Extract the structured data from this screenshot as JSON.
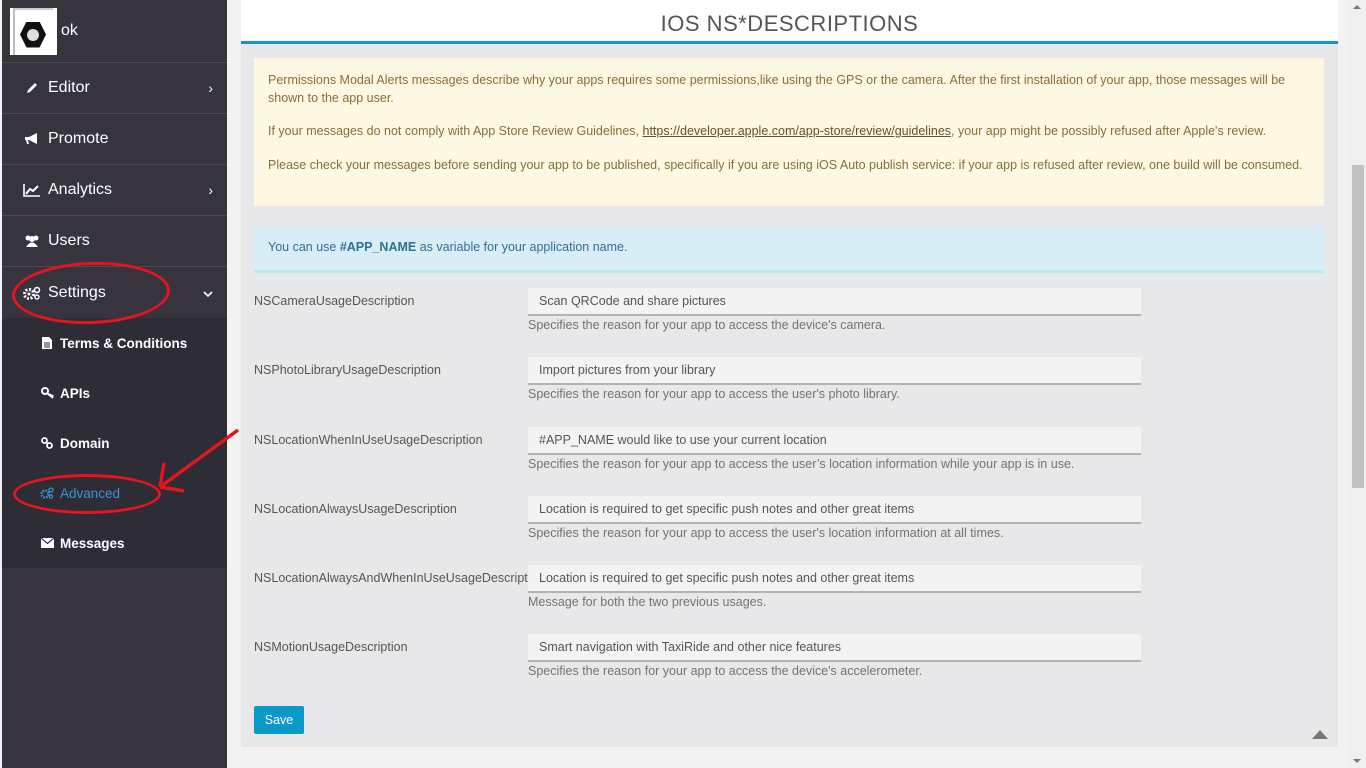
{
  "app": {
    "name": "ok"
  },
  "sidebar": {
    "items": [
      {
        "label": "Editor",
        "icon": "pencil-icon",
        "glyph": "✎",
        "chevron": "›"
      },
      {
        "label": "Promote",
        "icon": "bullhorn-icon",
        "glyph": "📢",
        "chevron": ""
      },
      {
        "label": "Analytics",
        "icon": "line-chart-icon",
        "glyph": "📈",
        "chevron": "›"
      },
      {
        "label": "Users",
        "icon": "users-icon",
        "glyph": "👥",
        "chevron": ""
      },
      {
        "label": "Settings",
        "icon": "gears-icon",
        "glyph": "⚙",
        "chevron": "⌄"
      }
    ],
    "settings_submenu": [
      {
        "label": "Terms & Conditions",
        "icon": "file-icon",
        "glyph": "📄"
      },
      {
        "label": "APIs",
        "icon": "key-icon",
        "glyph": "🔑"
      },
      {
        "label": "Domain",
        "icon": "link-icon",
        "glyph": "🔗"
      },
      {
        "label": "Advanced",
        "icon": "gears-icon",
        "glyph": "⚙",
        "active": true
      },
      {
        "label": "Messages",
        "icon": "envelope-icon",
        "glyph": "✉"
      }
    ]
  },
  "page": {
    "title": "IOS NS*DESCRIPTIONS",
    "warning": {
      "p1": "Permissions Modal Alerts messages describe why your apps requires some permissions,like using the GPS or the camera. After the first installation of your app, those messages will be shown to the app user.",
      "p2_before": "If your messages do not comply with App Store Review Guidelines, ",
      "p2_link": "https://developer.apple.com/app-store/review/guidelines",
      "p2_after": ", your app might be possibly refused after Apple's review.",
      "p3": "Please check your messages before sending your app to be published, specifically if you are using iOS Auto publish service: if your app is refused after review, one build will be consumed."
    },
    "info": {
      "before": "You can use ",
      "variable": "#APP_NAME",
      "after": " as variable for your application name."
    },
    "fields": [
      {
        "label": "NSCameraUsageDescription",
        "value": "Scan QRCode and share pictures",
        "help": "Specifies the reason for your app to access the device's camera."
      },
      {
        "label": "NSPhotoLibraryUsageDescription",
        "value": "Import pictures from your library",
        "help": "Specifies the reason for your app to access the user's photo library."
      },
      {
        "label": "NSLocationWhenInUseUsageDescription",
        "value": "#APP_NAME would like to use your current location",
        "help": "Specifies the reason for your app to access the user’s location information while your app is in use."
      },
      {
        "label": "NSLocationAlwaysUsageDescription",
        "value": "Location is required to get specific push notes and other great items",
        "help": "Specifies the reason for your app to access the user's location information at all times."
      },
      {
        "label": "NSLocationAlwaysAndWhenInUseUsageDescription",
        "value": "Location is required to get specific push notes and other great items",
        "help": "Message for both the two previous usages."
      },
      {
        "label": "NSMotionUsageDescription",
        "value": "Smart navigation with TaxiRide and other nice features",
        "help": "Specifies the reason for your app to access the device's accelerometer."
      }
    ],
    "save_label": "Save"
  },
  "colors": {
    "accent": "#1497c8",
    "sidebar_bg": "#37343e",
    "active_link": "#3a94d9",
    "annotation": "#e5141f"
  }
}
